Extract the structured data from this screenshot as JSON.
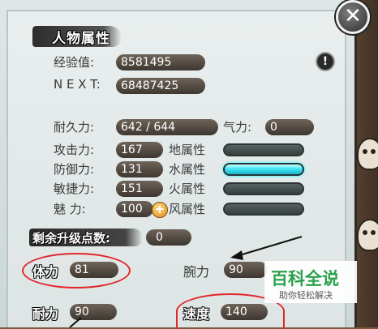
{
  "panel_title": "人物属性",
  "close_label": "✕",
  "hint_label": "!",
  "experience": {
    "label": "经验值:",
    "value": "8581495"
  },
  "next": {
    "label": "N E X T:",
    "value": "68487425"
  },
  "durability": {
    "label": "耐久力:",
    "value": "642  /  644"
  },
  "qi": {
    "label": "气力:",
    "value": "0"
  },
  "attack": {
    "label": "攻击力:",
    "value": "167"
  },
  "defense": {
    "label": "防御力:",
    "value": "131"
  },
  "agility": {
    "label": "敏捷力:",
    "value": "151"
  },
  "charm": {
    "label": "魅    力:",
    "value": "100"
  },
  "plus_label": "+",
  "elements": [
    {
      "label": "地属性",
      "active": false
    },
    {
      "label": "水属性",
      "active": true
    },
    {
      "label": "火属性",
      "active": false
    },
    {
      "label": "风属性",
      "active": false
    }
  ],
  "remaining_points": {
    "label": "剩余升级点数:",
    "value": "0"
  },
  "stats": {
    "stamina": {
      "label": "体力",
      "value": "81"
    },
    "strength": {
      "label": "腕力",
      "value": "90"
    },
    "endurance": {
      "label": "耐力",
      "value": "90"
    },
    "speed": {
      "label": "速度",
      "value": "140"
    }
  },
  "watermark": {
    "logo": "百科全说",
    "sub": "助你轻松解决"
  },
  "colors": {
    "highlight_circle": "#e2262a",
    "active_bar": "#3fe6f5"
  }
}
